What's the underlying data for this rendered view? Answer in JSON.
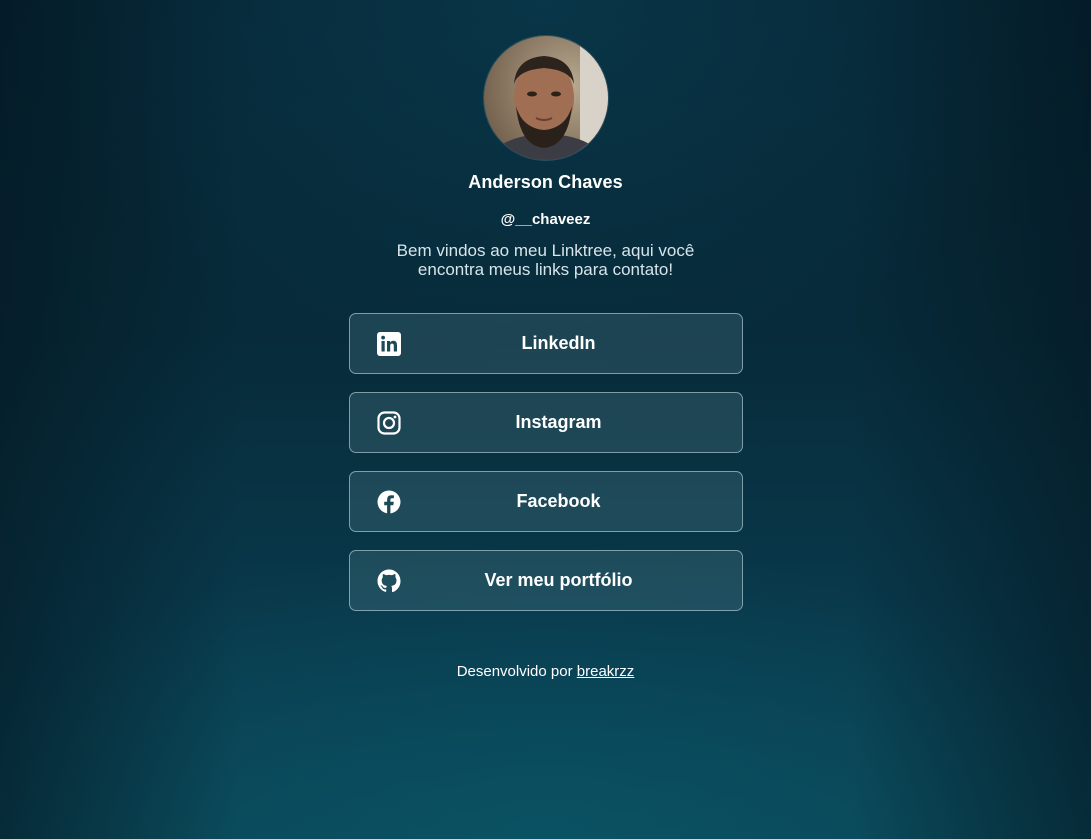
{
  "profile": {
    "name": "Anderson Chaves",
    "handle": "@__chaveez",
    "bio": "Bem vindos ao meu Linktree, aqui você encontra meus links para contato!"
  },
  "links": [
    {
      "label": "LinkedIn",
      "icon": "linkedin-icon"
    },
    {
      "label": "Instagram",
      "icon": "instagram-icon"
    },
    {
      "label": "Facebook",
      "icon": "facebook-icon"
    },
    {
      "label": "Ver meu portfólio",
      "icon": "github-icon"
    }
  ],
  "footer": {
    "prefix": "Desenvolvido por",
    "author": "breakrzz"
  },
  "colors": {
    "background_top": "#062635",
    "background_bottom": "#0b4656",
    "button_border": "#d2e6ee",
    "text": "#ffffff"
  }
}
